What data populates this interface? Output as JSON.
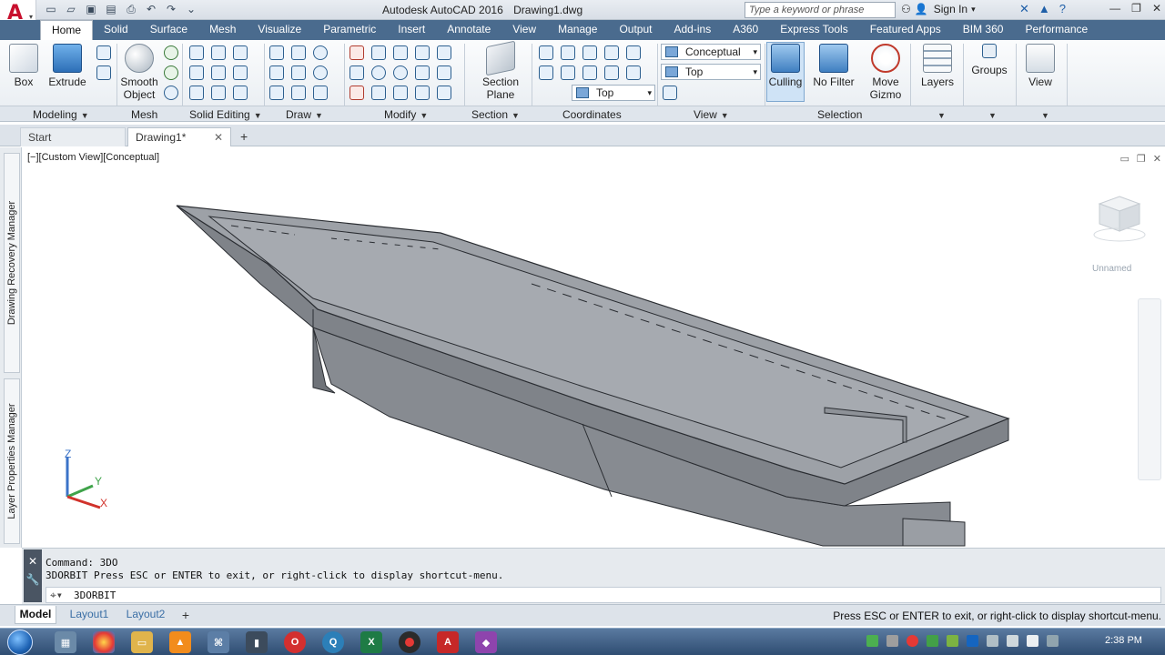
{
  "window": {
    "app_name": "Autodesk AutoCAD 2016",
    "file_name": "Drawing1.dwg",
    "search_placeholder": "Type a keyword or phrase",
    "sign_in_label": "Sign In"
  },
  "ribbon": {
    "tabs": [
      "Home",
      "Solid",
      "Surface",
      "Mesh",
      "Visualize",
      "Parametric",
      "Insert",
      "Annotate",
      "View",
      "Manage",
      "Output",
      "Add-ins",
      "A360",
      "Express Tools",
      "Featured Apps",
      "BIM 360",
      "Performance"
    ],
    "active_tab": "Home",
    "buttons": {
      "box": "Box",
      "extrude": "Extrude",
      "smooth_object": "Smooth Object",
      "section_plane": "Section Plane",
      "culling": "Culling",
      "no_filter": "No Filter",
      "move_gizmo": "Move Gizmo",
      "layers": "Layers",
      "groups": "Groups",
      "view": "View"
    },
    "panels": [
      "Modeling",
      "Mesh",
      "Solid Editing",
      "Draw",
      "Modify",
      "Section",
      "Coordinates",
      "View",
      "Selection"
    ],
    "combos": {
      "visual_style": "Conceptual",
      "view_dir": "Top",
      "ucs": "Top"
    }
  },
  "document_tabs": {
    "start": "Start",
    "drawing": "Drawing1*"
  },
  "side_palettes": {
    "drawing_recovery": "Drawing Recovery Manager",
    "layer_properties": "Layer Properties Manager"
  },
  "viewport": {
    "label": "[−][Custom View][Conceptual]",
    "ucs_name": "Unnamed",
    "axis_z": "Z",
    "axis_y": "Y",
    "axis_x": "X"
  },
  "command": {
    "history": [
      "Command: 3DO",
      "3DORBIT Press ESC or ENTER to exit, or right-click to display shortcut-menu."
    ],
    "current": "3DORBIT"
  },
  "layout_tabs": [
    "Model",
    "Layout1",
    "Layout2"
  ],
  "status_message": "Press ESC or ENTER to exit, or right-click to display shortcut-menu.",
  "taskbar": {
    "clock": "2:38 PM"
  },
  "colors": {
    "model_fill": "#8e9298",
    "model_edge": "#2a2d32",
    "ribbon_tab_bg": "#4a6b8e",
    "accent": "#c8102e"
  }
}
